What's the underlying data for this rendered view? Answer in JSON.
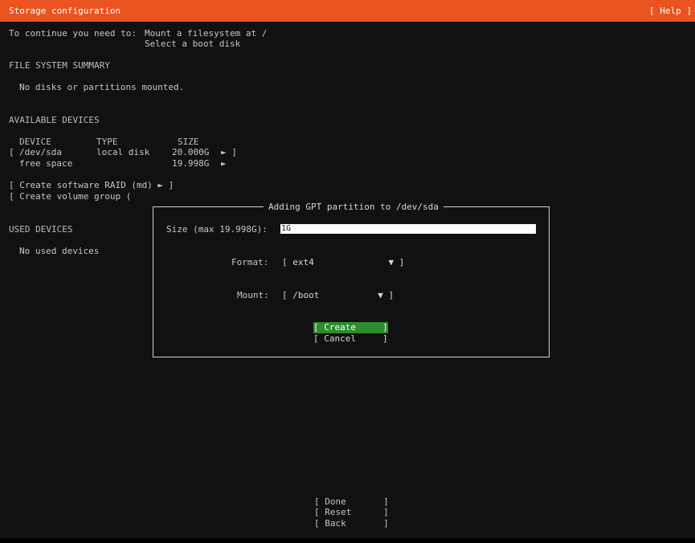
{
  "header": {
    "title": "Storage configuration",
    "help": "[ Help ]",
    "accent_color": "#e95420"
  },
  "requirements": {
    "prefix": "To continue you need to:",
    "items": [
      "Mount a filesystem at /",
      "Select a boot disk"
    ]
  },
  "fs_summary": {
    "heading": "FILE SYSTEM SUMMARY",
    "empty_text": "No disks or partitions mounted."
  },
  "available": {
    "heading": "AVAILABLE DEVICES",
    "columns": [
      "DEVICE",
      "TYPE",
      "SIZE"
    ],
    "rows": [
      {
        "lb": "[",
        "device": "/dev/sda",
        "type": "local disk",
        "size": "20.000G",
        "arrow": "► ]"
      },
      {
        "lb": "",
        "device": "free space",
        "type": "",
        "size": "19.998G",
        "arrow": "►"
      }
    ],
    "actions": [
      "[ Create software RAID (md) ► ]",
      "[ Create volume group ("
    ]
  },
  "used": {
    "heading": "USED DEVICES",
    "empty_text": "No used devices"
  },
  "dialog": {
    "title": "Adding GPT partition to /dev/sda",
    "size_label": "Size (max 19.998G):",
    "size_value": "1G",
    "format_label": "Format:",
    "format_value": "[ ext4              ▼ ]",
    "mount_label": "Mount:",
    "mount_value": "[ /boot           ▼ ]",
    "create_label": "[ Create     ]",
    "cancel_label": "[ Cancel     ]",
    "focus_color": "#2e8b2e"
  },
  "footer": {
    "done": "[ Done       ]",
    "reset": "[ Reset      ]",
    "back": "[ Back       ]"
  }
}
